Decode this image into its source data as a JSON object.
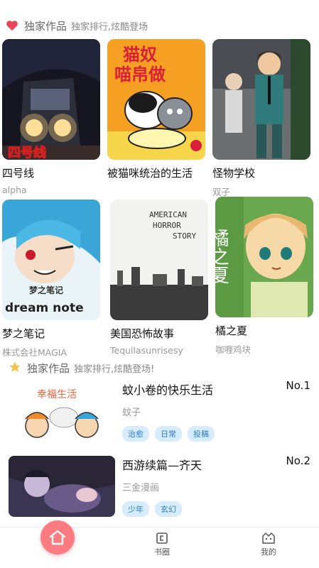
{
  "section1": {
    "title": "独家作品",
    "subtitle": "独家排行,炫酷登场",
    "icon": "heart-icon",
    "accent": "#e8455a",
    "items": [
      {
        "name": "四号线",
        "author": "alpha"
      },
      {
        "name": "被猫咪统治的生活",
        "author": ""
      },
      {
        "name": "怪物学校",
        "author": "双子"
      },
      {
        "name": "梦之笔记",
        "author": "株式会社MAGIA"
      },
      {
        "name": "美国恐怖故事",
        "author": "Tequilasunrisesy"
      },
      {
        "name": "橘之夏",
        "author": "咖喱鸡块"
      }
    ],
    "cover_text": {
      "line4": "四号线",
      "cat_title_1": "猫奴",
      "cat_title_2": "喵帛做",
      "dream_cn": "梦之笔记",
      "dream_en": "dream note",
      "horror_1": "AMERICAN",
      "horror_2": "HORROR",
      "horror_3": "STORY",
      "summer": "橘之夏"
    }
  },
  "section2": {
    "title": "独家作品",
    "subtitle": "独家排行,炫酷登场!",
    "icon": "star-icon",
    "ranks": [
      {
        "title": "蚊小卷的快乐生活",
        "author": "蚊子",
        "rank": "No.1",
        "tags": [
          "治愈",
          "日常",
          "投稿"
        ],
        "thumb_text": "幸福生活"
      },
      {
        "title": "西游续篇—齐天",
        "author": "三金漫画",
        "rank": "No.2",
        "tags": [
          "少年",
          "玄幻"
        ]
      }
    ]
  },
  "tabbar": {
    "home_icon": "home-icon",
    "bookshelf_label": "书圈",
    "mine_label": "我的"
  }
}
